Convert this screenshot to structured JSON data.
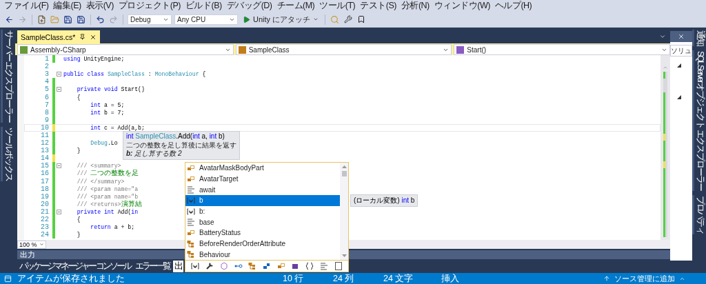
{
  "menu": [
    "ファイル(F)",
    "編集(E)",
    "表示(V)",
    "プロジェクト(P)",
    "ビルド(B)",
    "デバッグ(D)",
    "チーム(M)",
    "ツール(T)",
    "テスト(S)",
    "分析(N)",
    "ウィンドウ(W)",
    "ヘルプ(H)"
  ],
  "toolbar": {
    "configuration": "Debug",
    "platform": "Any CPU",
    "run_label": "Unity にアタッチ"
  },
  "left_tool_tabs": [
    "サーバー エクスプローラー",
    "ツールボックス"
  ],
  "document_tabs": [
    {
      "label": "SampleClass.cs*",
      "selected": true
    }
  ],
  "navigation": [
    "Assembly-CSharp",
    "SampleClass",
    "Start()"
  ],
  "editor": {
    "lines": [
      {
        "number": "1",
        "color": "#57d043",
        "fold": false,
        "current": false,
        "tokens": [
          {
            "kind": "kw",
            "text": "using"
          },
          {
            "kind": "plain",
            "text": " UnityEngine;"
          }
        ]
      },
      {
        "number": "2",
        "fold": false,
        "current": false
      },
      {
        "number": "3",
        "fold": true,
        "current": false,
        "tokens": [
          {
            "kind": "kw",
            "text": "public class "
          },
          {
            "kind": "type",
            "text": "SampleClass"
          },
          {
            "kind": "plain",
            "text": " : "
          },
          {
            "kind": "type",
            "text": "MonoBehaviour"
          },
          {
            "kind": "plain",
            "text": " {"
          }
        ]
      },
      {
        "number": "4",
        "color": "#57d043",
        "fold": false,
        "current": false
      },
      {
        "number": "5",
        "color": "#57d043",
        "fold": true,
        "current": false,
        "tokens": [
          {
            "kind": "kw",
            "text": "    private void "
          },
          {
            "kind": "plain",
            "text": "Start()"
          }
        ]
      },
      {
        "number": "6",
        "color": "#57d043",
        "fold": false,
        "current": false,
        "tokens": [
          {
            "kind": "plain",
            "text": "    {"
          }
        ]
      },
      {
        "number": "7",
        "color": "#57d043",
        "fold": false,
        "current": false,
        "tokens": [
          {
            "kind": "kw",
            "text": "        int"
          },
          {
            "kind": "plain",
            "text": " a = 5;"
          }
        ]
      },
      {
        "number": "8",
        "color": "#57d043",
        "fold": false,
        "current": false,
        "tokens": [
          {
            "kind": "kw",
            "text": "        int"
          },
          {
            "kind": "plain",
            "text": " b = 7;"
          }
        ]
      },
      {
        "number": "9",
        "color": "#57d043",
        "fold": false,
        "current": false
      },
      {
        "number": "10",
        "color": "#efe44b",
        "fold": false,
        "current": true,
        "tokens": [
          {
            "kind": "kw",
            "text": "        int"
          },
          {
            "kind": "plain",
            "text": " c = Add(a,b"
          },
          {
            "kind": "error",
            "text": ";"
          }
        ]
      },
      {
        "number": "11",
        "color": "#57d043",
        "fold": false,
        "current": false
      },
      {
        "number": "12",
        "color": "#57d043",
        "fold": false,
        "current": false,
        "tokens": [
          {
            "kind": "type",
            "text": "        Debug"
          },
          {
            "kind": "plain",
            "text": ".Lo"
          }
        ]
      },
      {
        "number": "13",
        "color": "#57d043",
        "fold": false,
        "current": false,
        "tokens": [
          {
            "kind": "plain",
            "text": "    }"
          }
        ]
      },
      {
        "number": "14",
        "color": "#efe44b",
        "fold": false,
        "current": false
      },
      {
        "number": "15",
        "color": "#57d043",
        "fold": true,
        "current": false,
        "tokens": [
          {
            "kind": "doc",
            "text": "    /// <summary>"
          }
        ]
      },
      {
        "number": "16",
        "color": "#57d043",
        "fold": false,
        "current": false,
        "tokens": [
          {
            "kind": "doc",
            "text": "    /// "
          },
          {
            "kind": "comment",
            "text": "二つの整数を足"
          }
        ]
      },
      {
        "number": "17",
        "color": "#57d043",
        "fold": false,
        "current": false,
        "tokens": [
          {
            "kind": "doc",
            "text": "    /// </summary>"
          }
        ]
      },
      {
        "number": "18",
        "color": "#57d043",
        "fold": false,
        "current": false,
        "tokens": [
          {
            "kind": "doc",
            "text": "    /// <param name=\"a"
          }
        ]
      },
      {
        "number": "19",
        "color": "#57d043",
        "fold": false,
        "current": false,
        "tokens": [
          {
            "kind": "doc",
            "text": "    /// <param name=\"b"
          }
        ]
      },
      {
        "number": "20",
        "color": "#57d043",
        "fold": false,
        "current": false,
        "tokens": [
          {
            "kind": "doc",
            "text": "    /// <returns>"
          },
          {
            "kind": "comment",
            "text": "演算結"
          }
        ]
      },
      {
        "number": "21",
        "color": "#57d043",
        "fold": true,
        "current": false,
        "tokens": [
          {
            "kind": "kw",
            "text": "    private int "
          },
          {
            "kind": "plain",
            "text": "Add("
          },
          {
            "kind": "kw",
            "text": "in"
          }
        ]
      },
      {
        "number": "22",
        "color": "#57d043",
        "fold": false,
        "current": false,
        "tokens": [
          {
            "kind": "plain",
            "text": "    {"
          }
        ]
      },
      {
        "number": "23",
        "color": "#57d043",
        "fold": false,
        "current": false,
        "tokens": [
          {
            "kind": "kw",
            "text": "        return"
          },
          {
            "kind": "plain",
            "text": " a + b;"
          }
        ]
      },
      {
        "number": "24",
        "color": "#57d043",
        "fold": false,
        "current": false,
        "tokens": [
          {
            "kind": "plain",
            "text": "    }"
          }
        ]
      }
    ]
  },
  "zoom": "100 %",
  "signature_help": {
    "signature": [
      {
        "kind": "kw",
        "text": "int "
      },
      {
        "kind": "type",
        "text": "SampleClass"
      },
      {
        "kind": "plain",
        "text": ".Add("
      },
      {
        "kind": "kw",
        "text": "int"
      },
      {
        "kind": "plain",
        "text": " a, "
      },
      {
        "kind": "kw",
        "text": "int"
      },
      {
        "kind": "plain",
        "text": " b)"
      }
    ],
    "description": "二つの整数を足し算後に結果を返す",
    "parameter": "**b:** 足し算する数 2"
  },
  "completion": {
    "items": [
      {
        "label": "AvatarMaskBodyPart",
        "kind": "enum",
        "selected": false
      },
      {
        "label": "AvatarTarget",
        "kind": "enum",
        "selected": false
      },
      {
        "label": "await",
        "kind": "keyword",
        "selected": false
      },
      {
        "label": "b",
        "kind": "local",
        "selected": true
      },
      {
        "label": "b:",
        "kind": "local",
        "selected": false
      },
      {
        "label": "base",
        "kind": "keyword",
        "selected": false
      },
      {
        "label": "BatteryStatus",
        "kind": "enum",
        "selected": false
      },
      {
        "label": "BeforeRenderOrderAttribute",
        "kind": "class",
        "selected": false
      },
      {
        "label": "Behaviour",
        "kind": "class",
        "selected": false
      }
    ]
  },
  "item_tooltip": [
    {
      "kind": "plain",
      "text": "(ローカル変数) "
    },
    {
      "kind": "kw",
      "text": "int"
    },
    {
      "kind": "plain",
      "text": " b"
    }
  ],
  "output_panel": {
    "title": "出力",
    "tabs": [
      {
        "label": "パッケージ マネージャー コンソール",
        "selected": false
      },
      {
        "label": "エラー一覧",
        "selected": false
      },
      {
        "label": "出",
        "selected": true
      }
    ]
  },
  "solution_panel": {
    "search_placeholder": "ソリュ"
  },
  "right_tool_tabs": [
    "通知",
    "SQL Server オブジェクト エクスプローラー",
    "プロパティ"
  ],
  "status_bar": {
    "message": "アイテムが保存されました",
    "line": "10 行",
    "column": "24 列",
    "characters": "24 文字",
    "mode": "挿入",
    "source_control": "ソース管理に追加"
  }
}
